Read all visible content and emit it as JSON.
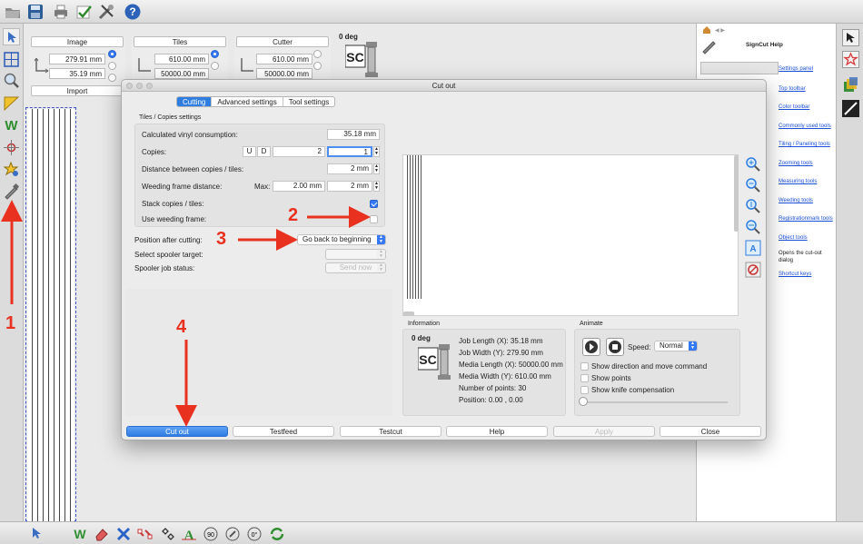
{
  "top_toolbar": {
    "icons": [
      "folder-open-icon",
      "save-icon",
      "printer-icon",
      "checkmark-icon",
      "tools-icon",
      "help-icon"
    ]
  },
  "panels": {
    "image": {
      "header": "Image",
      "x": "279.91 mm",
      "y": "35.19 mm",
      "button": "Import"
    },
    "tiles": {
      "header": "Tiles",
      "x": "610.00 mm",
      "y": "50000.00 mm"
    },
    "cutter": {
      "header": "Cutter",
      "x": "610.00 mm",
      "y": "50000.00 mm",
      "rotation": "0 deg"
    }
  },
  "help_panel": {
    "title": "SignCut Help",
    "links": [
      "Settings panel",
      "Top toolbar",
      "Color toolbar",
      "Commonly used tools",
      "Tiling / Paneling tools",
      "Zooming tools",
      "Measuring tools",
      "Weeding tools",
      "Registrationmark tools",
      "Object tools"
    ],
    "object_tools_note": "Opens the cut-out dialog",
    "last_link": "Shortcut keys"
  },
  "dialog": {
    "title": "Cut out",
    "tabs": [
      "Cutting",
      "Advanced settings",
      "Tool settings"
    ],
    "group_title": "Tiles / Copies settings",
    "calc_vinyl_label": "Calculated vinyl consumption:",
    "calc_vinyl_value": "35.18 mm",
    "copies_label": "Copies:",
    "copies_u": "U",
    "copies_d": "D",
    "copies_value1": "2",
    "copies_value2": "1",
    "distance_label": "Distance between copies / tiles:",
    "distance_value": "2 mm",
    "weed_label": "Weeding frame distance:",
    "weed_max_label": "Max:",
    "weed_max_value": "2.00 mm",
    "weed_value": "2 mm",
    "stack_label": "Stack copies / tiles:",
    "use_weed_label": "Use weeding frame:",
    "position_label": "Position after cutting:",
    "position_value": "Go back to beginning",
    "spooler_target_label": "Select spooler target:",
    "spooler_status_label": "Spooler job status:",
    "spooler_status_value": "Send now",
    "info_title": "Information",
    "info_deg": "0 deg",
    "info_lines": [
      "Job Length (X): 35.18 mm",
      "Job Width (Y): 279.90 mm",
      "Media Length (X): 50000.00 mm",
      "Media Width (Y): 610.00 mm",
      "Number of points: 30",
      "Position: 0.00 , 0.00"
    ],
    "animate_title": "Animate",
    "speed_label": "Speed:",
    "speed_value": "Normal",
    "show_direction": "Show direction and move command",
    "show_points": "Show points",
    "show_knife": "Show knife compensation",
    "buttons": [
      "Cut out",
      "Testfeed",
      "Testcut",
      "Help",
      "Apply",
      "Close"
    ]
  },
  "annotations": [
    "1",
    "2",
    "3",
    "4"
  ],
  "colors": {
    "accent": "#2f7de1",
    "annotation": "#e8311f"
  }
}
